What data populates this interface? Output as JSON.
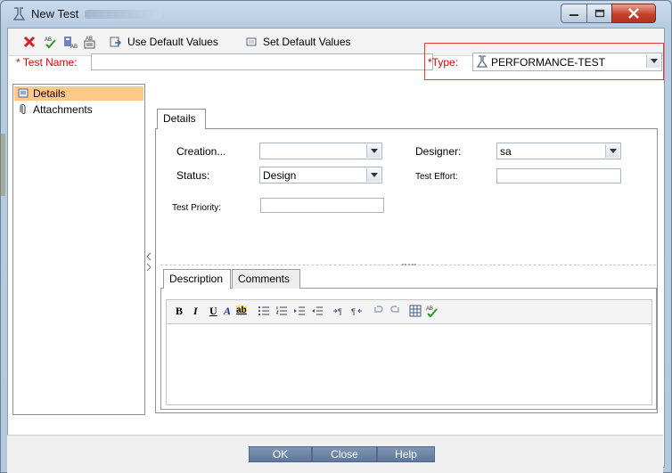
{
  "window": {
    "title": "New Test"
  },
  "toolbar": {
    "use_default_values": "Use Default Values",
    "set_default_values": "Set Default Values"
  },
  "header": {
    "test_name_required_mark": "*",
    "test_name_label": "Test Name:",
    "type_required_mark": "*",
    "type_label": "Type:",
    "type_value": "PERFORMANCE-TEST"
  },
  "sidebar": {
    "items": [
      {
        "label": "Details",
        "selected": true
      },
      {
        "label": "Attachments",
        "selected": false
      }
    ]
  },
  "details_tab": {
    "label": "Details"
  },
  "fields": {
    "creation_label": "Creation...",
    "creation_value": "",
    "designer_label": "Designer:",
    "designer_value": "sa",
    "status_label": "Status:",
    "status_value": "Design",
    "test_effort_label": "Test Effort:",
    "test_effort_value": "",
    "test_priority_label": "Test Priority:",
    "test_priority_value": ""
  },
  "bottom_tabs": [
    {
      "label": "Description",
      "active": true
    },
    {
      "label": "Comments",
      "active": false
    }
  ],
  "rte_toolbar": {
    "bold": "B",
    "italic": "I",
    "underline": "U",
    "font_color": "A",
    "highlight": "ab"
  },
  "footer": {
    "ok": "OK",
    "close": "Close",
    "help": "Help"
  },
  "colors": {
    "selected_item_bg": "#ffc98a",
    "required": "#e00000",
    "type_highlight_border": "#e43b3b",
    "footer_button": "#6b84a5"
  }
}
